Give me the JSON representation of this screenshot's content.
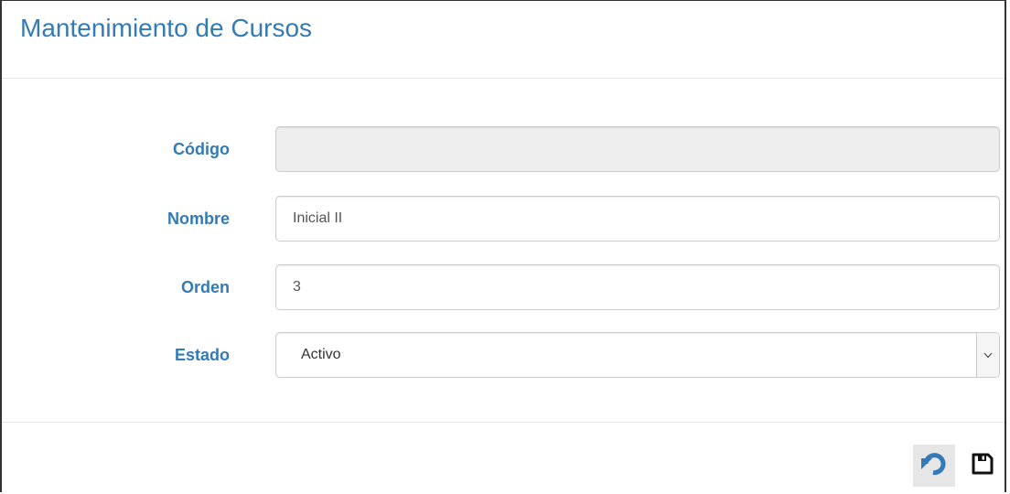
{
  "modal": {
    "title": "Mantenimiento de Cursos"
  },
  "form": {
    "codigo": {
      "label": "Código",
      "value": ""
    },
    "nombre": {
      "label": "Nombre",
      "value": "Inicial II"
    },
    "orden": {
      "label": "Orden",
      "value": "3"
    },
    "estado": {
      "label": "Estado",
      "value": "Activo",
      "options": [
        "Activo"
      ]
    }
  },
  "footer": {
    "buttons": [
      {
        "icon": "undo-icon",
        "color": "#337ab7"
      },
      {
        "icon": "save-icon",
        "color": "#111111"
      }
    ]
  },
  "colors": {
    "accent": "#337ab7",
    "disabled_bg": "#eeeeee",
    "border": "#cccccc"
  }
}
